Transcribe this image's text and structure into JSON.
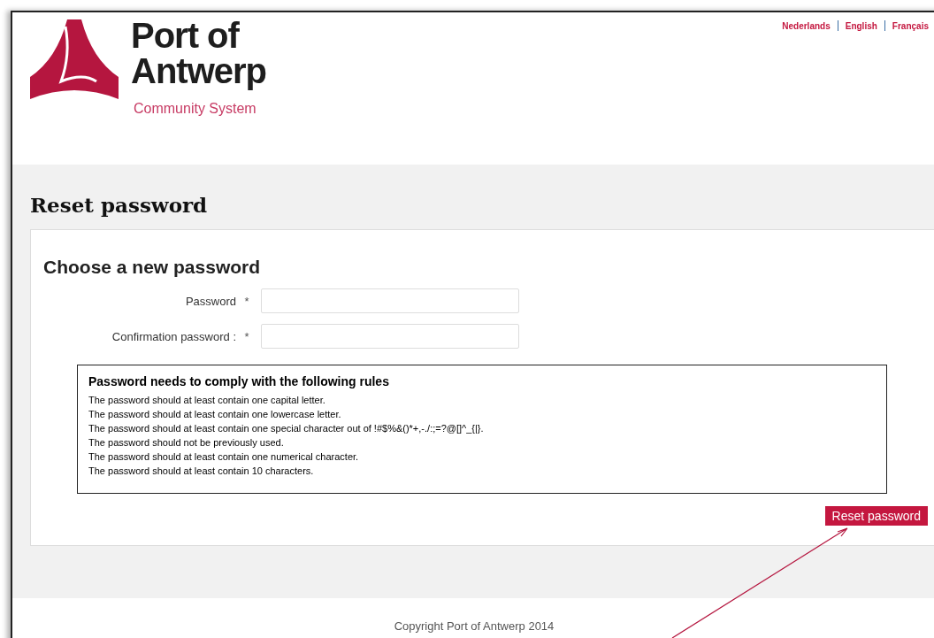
{
  "header": {
    "logo": {
      "title_line_1": "Port of",
      "title_line_2": "Antwerp",
      "subtitle": "Community System"
    },
    "languages": [
      "Nederlands",
      "English",
      "Français"
    ]
  },
  "page_title": "Reset password",
  "form": {
    "heading": "Choose a new password",
    "fields": [
      {
        "label": "Password",
        "required_mark": "*"
      },
      {
        "label": "Confirmation password :",
        "required_mark": "*"
      }
    ],
    "rules": {
      "title": "Password needs to comply with the following rules",
      "items": [
        "The password should at least contain one capital letter.",
        "The password should at least contain one lowercase letter.",
        "The password should at least contain one special character out of !#$%&()*+,-./:;=?@[]^_{|}.",
        "The password should not be previously used.",
        "The password should at least contain one numerical character.",
        "The password should at least contain 10 characters."
      ]
    },
    "submit": "Reset password"
  },
  "footer": {
    "copyright": "Copyright Port of Antwerp 2014"
  }
}
